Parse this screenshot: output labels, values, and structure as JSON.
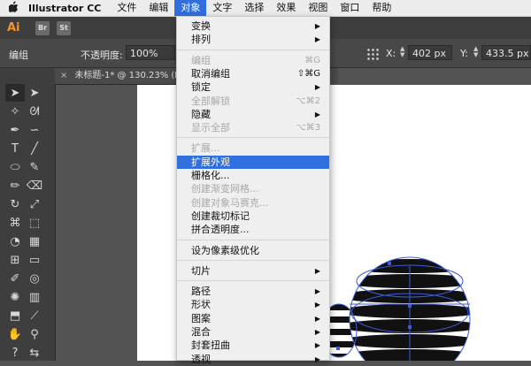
{
  "menubar": {
    "apple": "",
    "app_name": "Illustrator CC",
    "items": [
      "文件",
      "编辑",
      "对象",
      "文字",
      "选择",
      "效果",
      "视图",
      "窗口",
      "帮助"
    ],
    "active_index": 2
  },
  "appbar": {
    "logo": "Ai",
    "badges": [
      "Br",
      "St"
    ]
  },
  "controlbar": {
    "selection_label": "编组",
    "opacity_label": "不透明度:",
    "opacity_value": "100%",
    "x_label": "X:",
    "x_value": "402 px",
    "y_label": "Y:",
    "y_value": "433.5 px"
  },
  "tab": {
    "close": "×",
    "title": "未标题-1* @ 130.23% (RGB/G"
  },
  "tools": [
    {
      "name": "selection-tool-icon",
      "glyph": "➤"
    },
    {
      "name": "direct-selection-tool-icon",
      "glyph": "➤"
    },
    {
      "name": "magic-wand-tool-icon",
      "glyph": "✧"
    },
    {
      "name": "lasso-tool-icon",
      "glyph": "ᘛ"
    },
    {
      "name": "pen-tool-icon",
      "glyph": "✒"
    },
    {
      "name": "curvature-tool-icon",
      "glyph": "∽"
    },
    {
      "name": "type-tool-icon",
      "glyph": "T"
    },
    {
      "name": "line-tool-icon",
      "glyph": "╱"
    },
    {
      "name": "ellipse-tool-icon",
      "glyph": "⬭"
    },
    {
      "name": "paintbrush-tool-icon",
      "glyph": "✎"
    },
    {
      "name": "pencil-tool-icon",
      "glyph": "✏"
    },
    {
      "name": "eraser-tool-icon",
      "glyph": "⌫"
    },
    {
      "name": "rotate-tool-icon",
      "glyph": "↻"
    },
    {
      "name": "scale-tool-icon",
      "glyph": "⤢"
    },
    {
      "name": "width-tool-icon",
      "glyph": "⌘"
    },
    {
      "name": "free-transform-tool-icon",
      "glyph": "⬚"
    },
    {
      "name": "shape-builder-tool-icon",
      "glyph": "◔"
    },
    {
      "name": "perspective-grid-tool-icon",
      "glyph": "▦"
    },
    {
      "name": "mesh-tool-icon",
      "glyph": "⊞"
    },
    {
      "name": "gradient-tool-icon",
      "glyph": "▭"
    },
    {
      "name": "eyedropper-tool-icon",
      "glyph": "✐"
    },
    {
      "name": "blend-tool-icon",
      "glyph": "◎"
    },
    {
      "name": "symbol-sprayer-tool-icon",
      "glyph": "✺"
    },
    {
      "name": "column-graph-tool-icon",
      "glyph": "▥"
    },
    {
      "name": "artboard-tool-icon",
      "glyph": "⬒"
    },
    {
      "name": "slice-tool-icon",
      "glyph": "⟋"
    },
    {
      "name": "hand-tool-icon",
      "glyph": "✋"
    },
    {
      "name": "zoom-tool-icon",
      "glyph": "⚲"
    },
    {
      "name": "fill-stroke-icon",
      "glyph": "?"
    },
    {
      "name": "swap-icon",
      "glyph": "⇆"
    }
  ],
  "menu": {
    "items": [
      {
        "label": "变换",
        "submenu": true,
        "enabled": true
      },
      {
        "label": "排列",
        "submenu": true,
        "enabled": true
      },
      {
        "sep": true
      },
      {
        "label": "编组",
        "shortcut": "⌘G",
        "enabled": false
      },
      {
        "label": "取消编组",
        "shortcut": "⇧⌘G",
        "enabled": true
      },
      {
        "label": "锁定",
        "submenu": true,
        "enabled": true
      },
      {
        "label": "全部解锁",
        "shortcut": "⌥⌘2",
        "enabled": false
      },
      {
        "label": "隐藏",
        "submenu": true,
        "enabled": true
      },
      {
        "label": "显示全部",
        "shortcut": "⌥⌘3",
        "enabled": false
      },
      {
        "sep": true
      },
      {
        "label": "扩展...",
        "enabled": false
      },
      {
        "label": "扩展外观",
        "enabled": true,
        "highlighted": true
      },
      {
        "label": "栅格化...",
        "enabled": true
      },
      {
        "label": "创建渐变网格...",
        "enabled": false
      },
      {
        "label": "创建对象马赛克...",
        "enabled": false
      },
      {
        "label": "创建裁切标记",
        "enabled": true
      },
      {
        "label": "拼合透明度...",
        "enabled": true
      },
      {
        "sep": true
      },
      {
        "label": "设为像素级优化",
        "enabled": true
      },
      {
        "sep": true
      },
      {
        "label": "切片",
        "submenu": true,
        "enabled": true
      },
      {
        "sep": true
      },
      {
        "label": "路径",
        "submenu": true,
        "enabled": true
      },
      {
        "label": "形状",
        "submenu": true,
        "enabled": true
      },
      {
        "label": "图案",
        "submenu": true,
        "enabled": true
      },
      {
        "label": "混合",
        "submenu": true,
        "enabled": true
      },
      {
        "label": "封套扭曲",
        "submenu": true,
        "enabled": true
      },
      {
        "label": "透视",
        "submenu": true,
        "enabled": true
      }
    ]
  },
  "colors": {
    "menu_highlight": "#2f6fdf",
    "selection_outline": "#3d5bd9",
    "ai_orange": "#f3932a"
  }
}
